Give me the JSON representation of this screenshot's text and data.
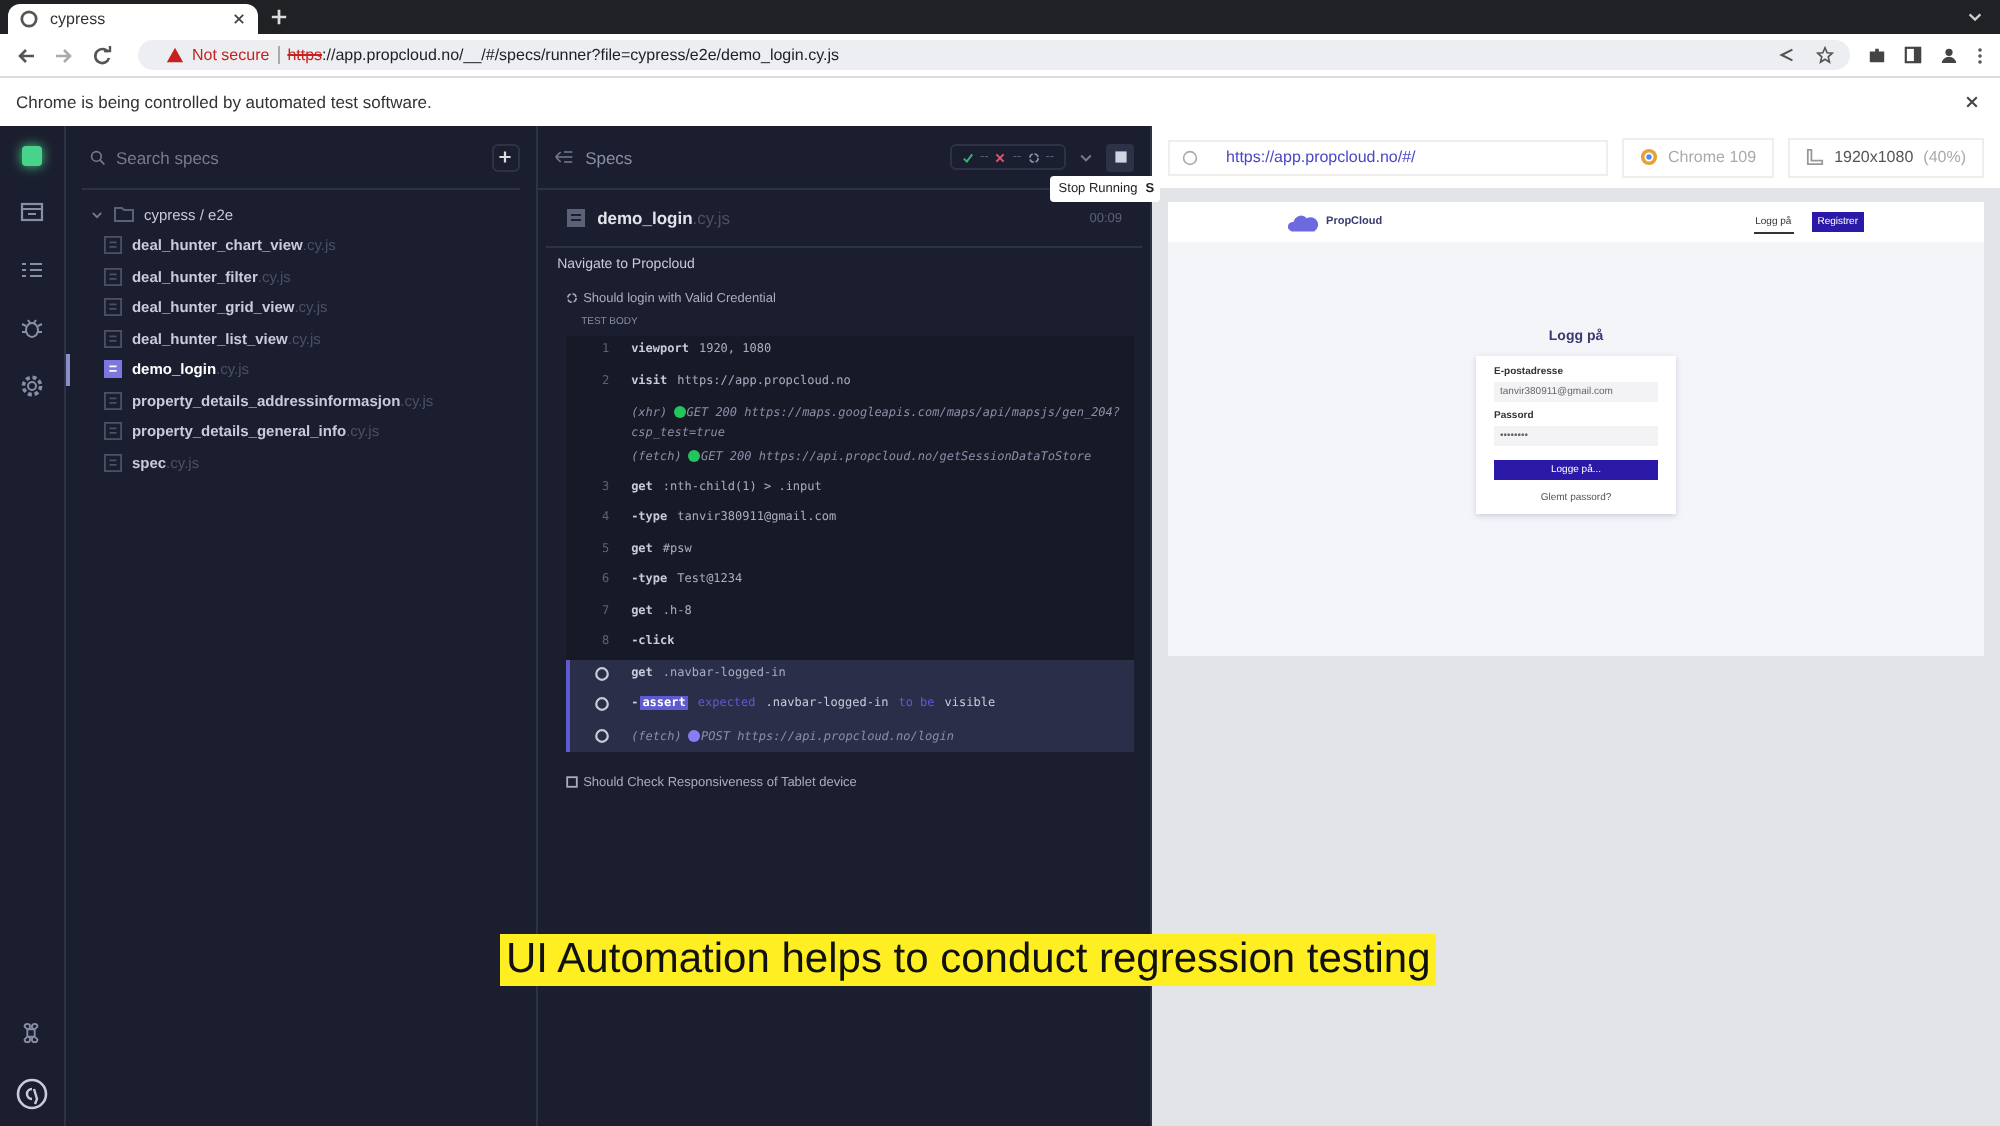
{
  "browser": {
    "tab": {
      "title": "cypress"
    },
    "security": "Not secure",
    "url_scheme": "https",
    "url_rest": "://app.propcloud.no/__/#/specs/runner?file=cypress/e2e/demo_login.cy.js",
    "infobar": "Chrome is being controlled by automated test software."
  },
  "specs": {
    "search": {
      "placeholder": "Search specs"
    },
    "folder": {
      "name": "cypress / e2e",
      "expanded": true
    },
    "items": [
      {
        "name": "deal_hunter_chart_view",
        "ext": ".cy.js",
        "selected": false
      },
      {
        "name": "deal_hunter_filter",
        "ext": ".cy.js",
        "selected": false
      },
      {
        "name": "deal_hunter_grid_view",
        "ext": ".cy.js",
        "selected": false
      },
      {
        "name": "deal_hunter_list_view",
        "ext": ".cy.js",
        "selected": false
      },
      {
        "name": "demo_login",
        "ext": ".cy.js",
        "selected": true
      },
      {
        "name": "property_details_addressinformasjon",
        "ext": ".cy.js",
        "selected": false
      },
      {
        "name": "property_details_general_info",
        "ext": ".cy.js",
        "selected": false
      },
      {
        "name": "spec",
        "ext": ".cy.js",
        "selected": false
      }
    ]
  },
  "runner": {
    "title": "Specs",
    "stats": {
      "passed": "--",
      "failed": "--",
      "pending": "--"
    },
    "tooltip": {
      "label": "Stop Running",
      "key": "S"
    },
    "spec": {
      "name": "demo_login",
      "ext": ".cy.js",
      "time": "00:09"
    },
    "suite": "Navigate to Propcloud",
    "tests": [
      {
        "title": "Should login with Valid Credential"
      },
      {
        "title": "Should Check Responsiveness of Tablet device"
      }
    ],
    "body_label": "TEST BODY",
    "commands": [
      {
        "kind": "command",
        "number": "1",
        "name": "viewport",
        "message": "1920, 1080",
        "pending": false
      },
      {
        "kind": "command",
        "number": "2",
        "name": "visit",
        "message": "https://app.propcloud.no",
        "pending": false
      },
      {
        "kind": "request",
        "name": "(xhr)",
        "method": "GET 200",
        "url": "https://maps.googleapis.com/maps/api/mapsjs/gen_204?csp_test=true",
        "color": "#22c55e",
        "pending": false
      },
      {
        "kind": "request",
        "name": "(fetch)",
        "method": "GET 200",
        "url": "https://api.propcloud.no/getSessionDataToStore",
        "color": "#22c55e",
        "pending": false
      },
      {
        "kind": "command",
        "number": "3",
        "name": "get",
        "message": ":nth-child(1) > .input",
        "pending": false
      },
      {
        "kind": "command",
        "number": "4",
        "name": "-type",
        "message": "tanvir380911@gmail.com",
        "pending": false
      },
      {
        "kind": "command",
        "number": "5",
        "name": "get",
        "message": "#psw",
        "pending": false
      },
      {
        "kind": "command",
        "number": "6",
        "name": "-type",
        "message": "Test@1234",
        "pending": false
      },
      {
        "kind": "command",
        "number": "7",
        "name": "get",
        "message": ".h-8",
        "pending": false
      },
      {
        "kind": "command",
        "number": "8",
        "name": "-click",
        "pending": false
      },
      {
        "kind": "command",
        "name": "get",
        "message": ".navbar-logged-in",
        "pending": true
      },
      {
        "kind": "assert",
        "prefix": "-",
        "name": "assert",
        "parts": [
          "expected",
          ".navbar-logged-in",
          "to be",
          "visible"
        ],
        "pending": true
      },
      {
        "kind": "request",
        "name": "(fetch)",
        "method": "POST",
        "url": "https://api.propcloud.no/login",
        "color": "#8b7cf6",
        "pending": true
      }
    ]
  },
  "aut": {
    "url": "https://app.propcloud.no/#/",
    "browser": "Chrome 109",
    "viewport": "1920x1080",
    "scale": "(40%)",
    "page": {
      "brand": "PropCloud",
      "nav": [
        {
          "label": "Logg på",
          "kind": "link"
        },
        {
          "label": "Registrer",
          "kind": "button"
        }
      ],
      "heading": "Logg på",
      "email_label": "E-postadresse",
      "email_value": "tanvir380911@gmail.com",
      "password_label": "Passord",
      "password_value": "••••••••",
      "submit": "Logge på...",
      "forgot": "Glemt passord?"
    }
  },
  "caption": "UI Automation helps to conduct regression testing"
}
